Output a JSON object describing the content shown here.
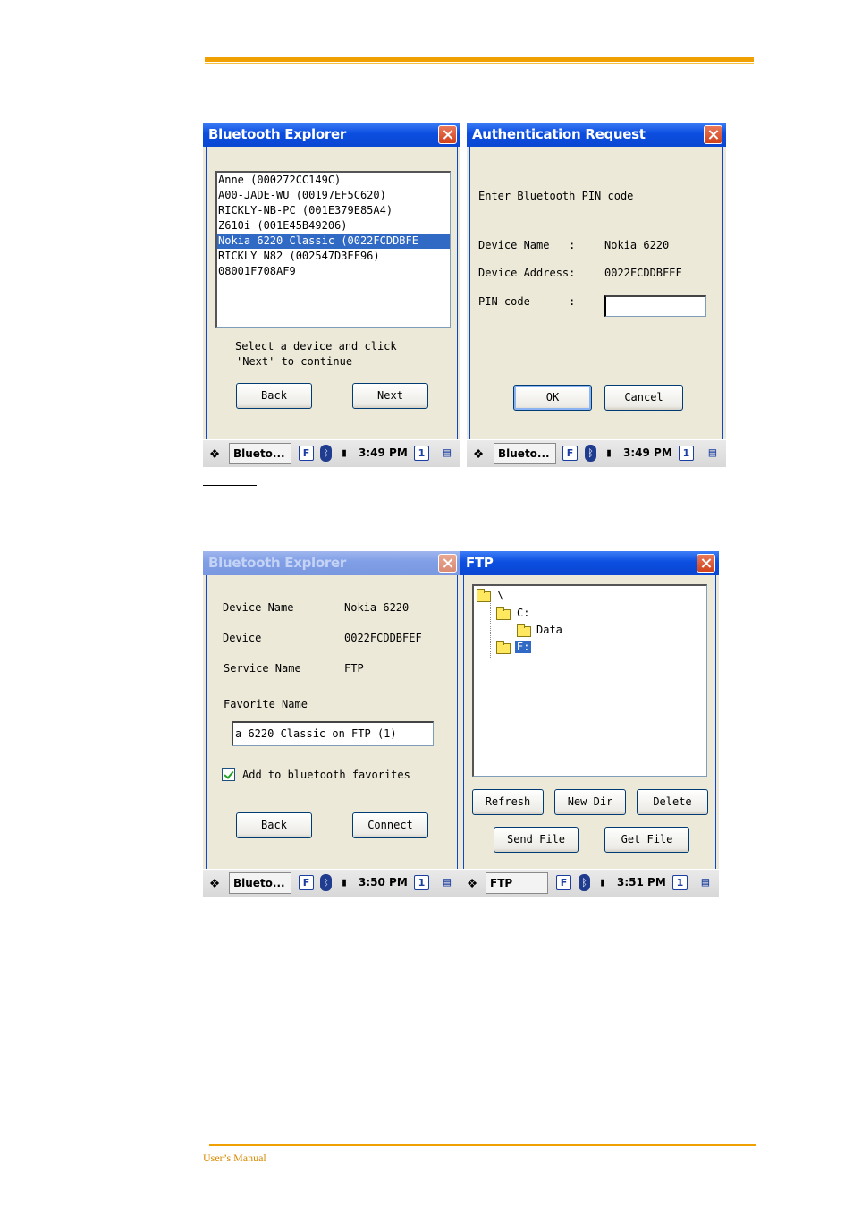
{
  "footer": {
    "text": "User’s Manual"
  },
  "explorer_list": {
    "title": "Bluetooth Explorer",
    "devices": [
      "Anne (000272CC149C)",
      "A00-JADE-WU (00197EF5C620)",
      "RICKLY-NB-PC (001E379E85A4)",
      "Z610i (001E45B49206)",
      "Nokia 6220 Classic (0022FCDDBFE",
      "RICKLY N82 (002547D3EF96)",
      "08001F708AF9"
    ],
    "selected_index": 4,
    "instruction_line1": "Select a device and click",
    "instruction_line2": "'Next' to continue",
    "back_label": "Back",
    "next_label": "Next"
  },
  "auth": {
    "title": "Authentication Request",
    "prompt": "Enter Bluetooth PIN code",
    "device_name_label": "Device Name   :",
    "device_name_value": "Nokia 6220",
    "device_address_label": "Device Address:",
    "device_address_value": "0022FCDDBFEF",
    "pin_label": "PIN code      :",
    "pin_value": "",
    "ok_label": "OK",
    "cancel_label": "Cancel"
  },
  "explorer_fav": {
    "title": "Bluetooth Explorer",
    "device_name_label": "Device Name",
    "device_name_value": "Nokia 6220",
    "device_label": "Device",
    "device_value": "0022FCDDBFEF",
    "service_label": "Service Name",
    "service_value": "FTP",
    "favorite_label": "Favorite Name",
    "favorite_value": "a 6220 Classic on FTP (1)",
    "checkbox_label": "Add to bluetooth favorites",
    "back_label": "Back",
    "connect_label": "Connect"
  },
  "ftp": {
    "title": "FTP",
    "tree": {
      "root": "\\",
      "c": "C:",
      "data": "Data",
      "e": "E:"
    },
    "refresh_label": "Refresh",
    "newdir_label": "New Dir",
    "delete_label": "Delete",
    "sendfile_label": "Send File",
    "getfile_label": "Get File"
  },
  "taskbars": {
    "tb1": {
      "task": "Blueto...",
      "time": "3:49 PM"
    },
    "tb2": {
      "task": "Blueto...",
      "time": "3:49 PM"
    },
    "tb3": {
      "task": "Blueto...",
      "time": "3:50 PM"
    },
    "tb4": {
      "task": "FTP",
      "time": "3:51 PM"
    },
    "f_glyph": "F",
    "desk_number": "1"
  },
  "icons": [
    "windows-start-icon",
    "close-icon",
    "bluetooth-icon",
    "battery-icon",
    "folder-icon",
    "desktop-switch-icon",
    "keyboard-f-icon"
  ]
}
